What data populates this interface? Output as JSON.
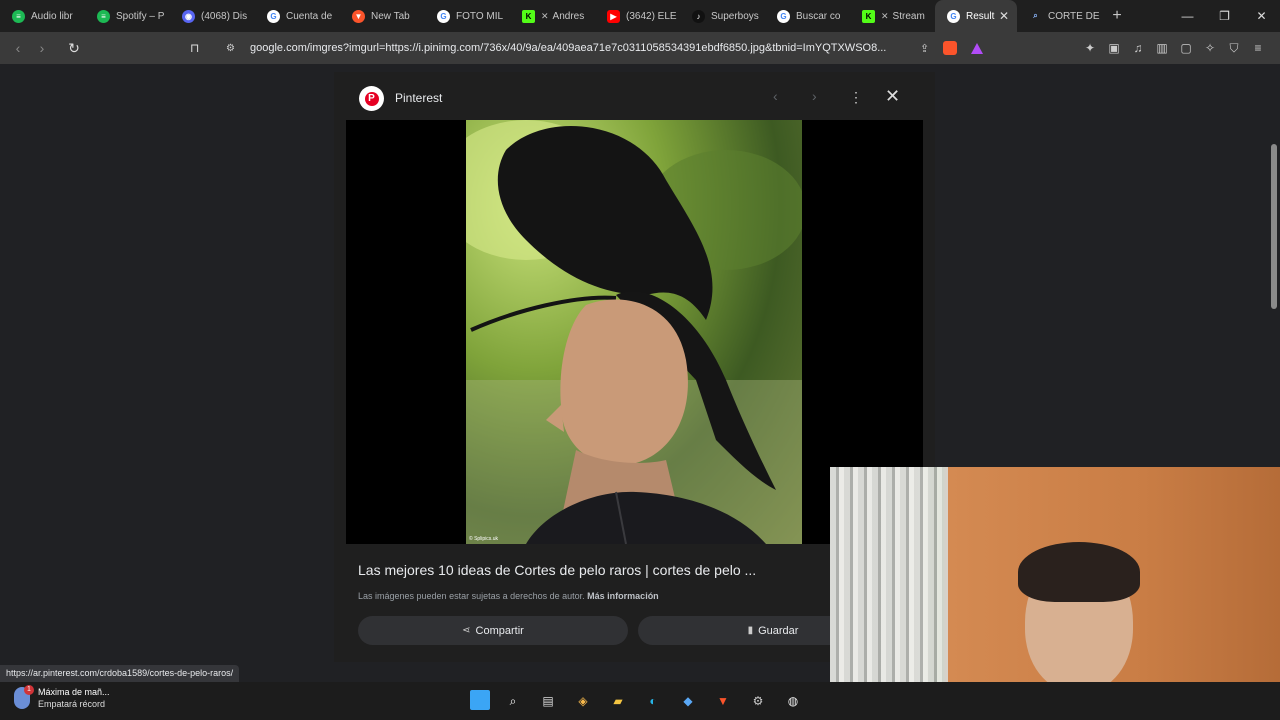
{
  "browser": {
    "tabs": [
      {
        "label": "Audio libr",
        "icon": "spotify-icon",
        "color": "#1db954"
      },
      {
        "label": "Spotify – P",
        "icon": "spotify-icon",
        "color": "#1db954"
      },
      {
        "label": "(4068) Dis",
        "icon": "discord-icon",
        "color": "#5865f2"
      },
      {
        "label": "Cuenta de",
        "icon": "google-icon",
        "color": "#4285f4"
      },
      {
        "label": "New Tab",
        "icon": "brave-icon",
        "color": "#fb542b"
      },
      {
        "label": "FOTO MIL",
        "icon": "google-icon",
        "color": "#4285f4"
      },
      {
        "label": "Andres",
        "icon": "kick-icon",
        "color": "#53fc18"
      },
      {
        "label": "(3642) ELE",
        "icon": "youtube-icon",
        "color": "#ff0000"
      },
      {
        "label": "Superboys",
        "icon": "tiktok-icon",
        "color": "#111111"
      },
      {
        "label": "Buscar co",
        "icon": "google-icon",
        "color": "#4285f4"
      },
      {
        "label": "Stream",
        "icon": "kick-icon",
        "color": "#53fc18"
      },
      {
        "label": "Result",
        "icon": "google-icon",
        "color": "#4285f4"
      },
      {
        "label": "CORTE DE",
        "icon": "search-icon",
        "color": "#8ab4f8"
      }
    ],
    "url": "google.com/imgres?imgurl=https://i.pinimg.com/736x/40/9a/ea/409aea71e7c0311058534391ebdf6850.jpg&tbnid=ImYQTXWSO8..."
  },
  "viewer": {
    "source": "Pinterest",
    "title": "Las mejores 10 ideas de Cortes de pelo raros | cortes de pelo ...",
    "copyright_note": "Las imágenes pueden estar sujetas a derechos de autor.",
    "more_info": "Más información",
    "share_label": "Compartir",
    "save_label": "Guardar",
    "photo_credit": "© Splipics.uk"
  },
  "status_url": "https://ar.pinterest.com/crdoba1589/cortes-de-pelo-raros/",
  "taskbar": {
    "weather_title": "Máxima de mañ...",
    "weather_sub": "Empatará récord",
    "weather_badge": "1"
  }
}
